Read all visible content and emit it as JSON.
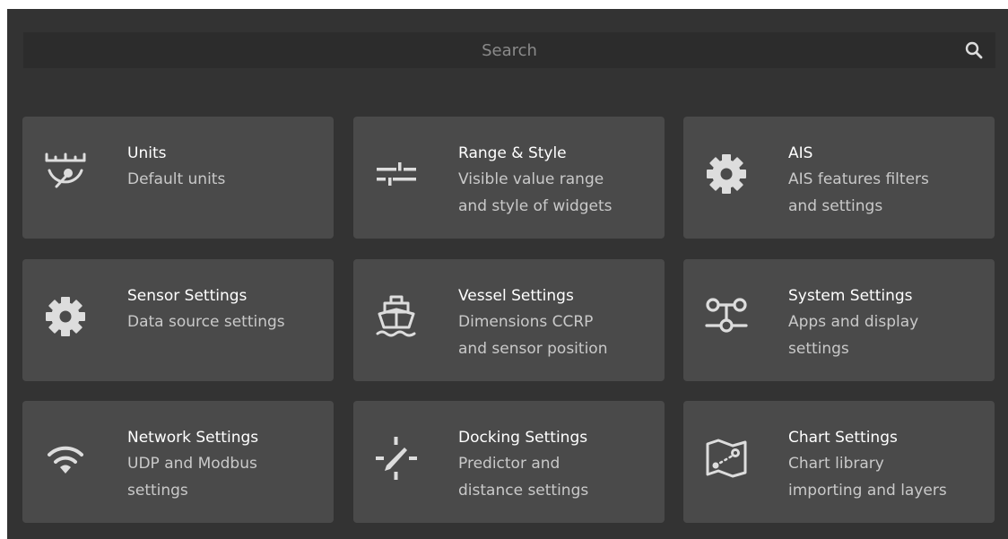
{
  "search": {
    "placeholder": "Search",
    "icon": "search-icon"
  },
  "colors": {
    "background": "#333333",
    "card": "#4a4a4a",
    "title": "#ffffff",
    "description": "#c9c9c9",
    "icon": "#dddddd"
  },
  "cards": [
    {
      "title": "Units",
      "desc1": "Default units",
      "desc2": "",
      "icon": "gauge-ruler-icon"
    },
    {
      "title": "Range & Style",
      "desc1": "Visible value range",
      "desc2": "and style of widgets",
      "icon": "sliders-icon"
    },
    {
      "title": "AIS",
      "desc1": "AIS features filters",
      "desc2": "and settings",
      "icon": "gear-icon"
    },
    {
      "title": "Sensor Settings",
      "desc1": "Data source settings",
      "desc2": "",
      "icon": "gear-icon"
    },
    {
      "title": "Vessel Settings",
      "desc1": "Dimensions CCRP",
      "desc2": "and sensor position",
      "icon": "ship-icon"
    },
    {
      "title": "System Settings",
      "desc1": "Apps and display",
      "desc2": "settings",
      "icon": "system-nodes-icon"
    },
    {
      "title": "Network Settings",
      "desc1": "UDP and Modbus",
      "desc2": "settings",
      "icon": "wifi-icon"
    },
    {
      "title": "Docking Settings",
      "desc1": "Predictor and",
      "desc2": "distance settings",
      "icon": "docking-icon"
    },
    {
      "title": "Chart Settings",
      "desc1": "Chart library",
      "desc2": "importing and layers",
      "icon": "map-icon"
    }
  ]
}
